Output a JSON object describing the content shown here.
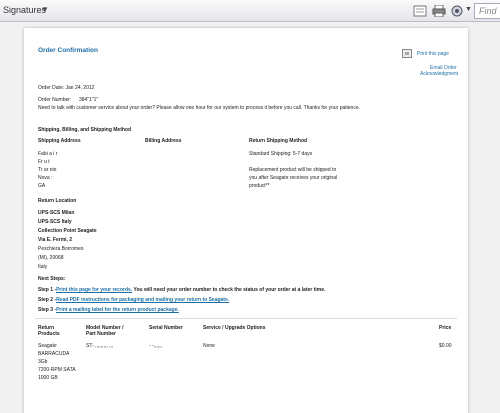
{
  "toolbar": {
    "signatures_label": "Signatures",
    "find_placeholder": "Find"
  },
  "order": {
    "title": "Order Confirmation",
    "print_link": "Print this page",
    "email_link": "Email Order",
    "ack_link": "Acknowledgment",
    "order_date": "Order Date: Jan 24, 2012",
    "order_number_label": "Order Number:",
    "order_number_value": "384\"1\"1\"",
    "help_text": "Need to talk with customer service about your order? Please allow one hour for our system to process it before you call. Thanks for your patience.",
    "section_heading": "Shipping, Billing, and Shipping Method",
    "col_shipping": "Shipping Address",
    "col_billing": "Billing Address",
    "col_return": "Return Shipping Method",
    "ship_line1": "Fabi   a   i r",
    "ship_line2": "Fr  u   t",
    "ship_line3": "Tr  ar   nio",
    "ship_line4": "Nova   :",
    "ship_line5": "GA",
    "return_method": "Standard Shipping: 5-7 days",
    "replacement_line1": "Replacement product will be shipped to",
    "replacement_line2": "you after Seagate receives your original",
    "replacement_line3": "product**",
    "return_location_heading": "Return Location",
    "loc1": "UPS-SCS Milan",
    "loc2": "UPS-SCS Italy",
    "loc3": "Collection Point Seagate",
    "loc4": "Via E. Fermi, 2",
    "loc5": "Peschiera Borromeo",
    "loc6": "(MI), 20068",
    "loc7": "Italy",
    "next_steps": "Next Steps:",
    "step1_prefix": "Step 1 -",
    "step1_link": "Print this page for your records.",
    "step1_rest": " You will need your order number to check the status of your order at a later time.",
    "step2_prefix": "Step 2 -",
    "step2_link": "Read PDF instructions for packaging and mailing your return to Seagate.",
    "step3_prefix": "Step 3 -",
    "step3_link": "Print a mailing label for the return product package.",
    "th_products_1": "Return",
    "th_products_2": "Products",
    "th_model_1": "Model Number /",
    "th_model_2": "Part Number",
    "th_serial": "Serial Number",
    "th_service": "Service / Upgrade Options",
    "th_price": "Price",
    "row_product_1": "Seagate",
    "row_product_2": "BARRACUDA",
    "row_product_3": "3Gb",
    "row_product_4": "7200-RPM SATA",
    "row_product_5": "1000 GB",
    "row_model": "ST-  ,,,,,,,,, ,,,",
    "row_serial": "- -,,,,,,",
    "row_service": "None",
    "row_price": "$0.00"
  }
}
